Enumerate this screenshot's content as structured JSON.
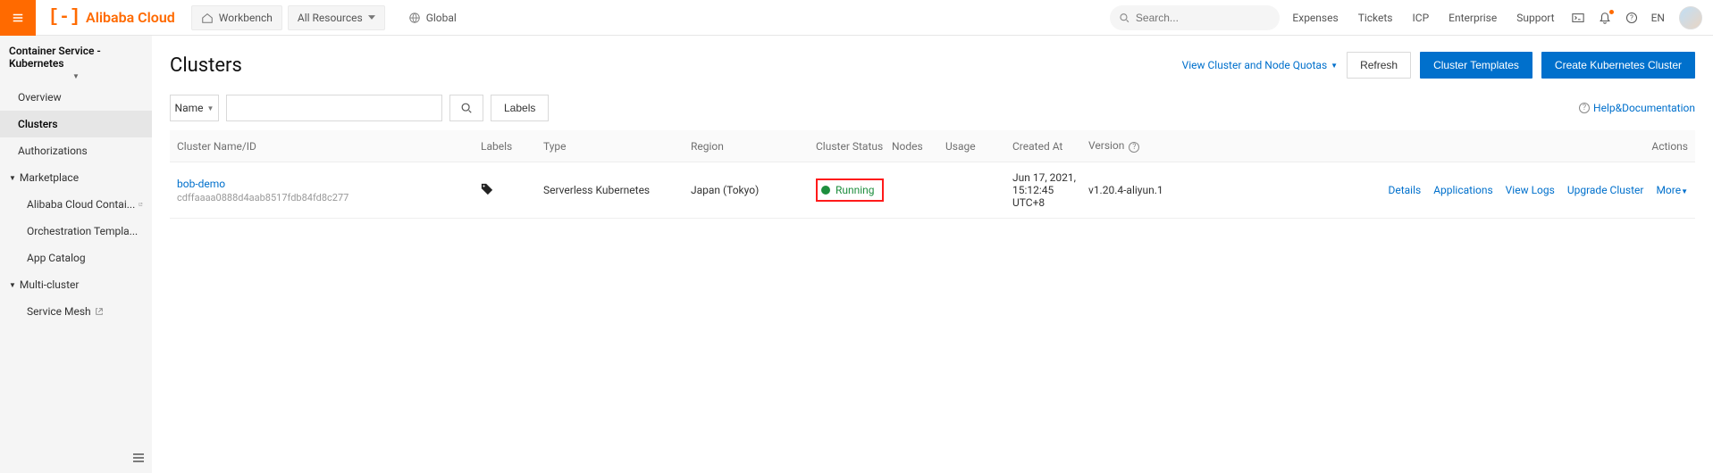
{
  "brand": "Alibaba Cloud",
  "topbar": {
    "workbench": "Workbench",
    "all_resources": "All Resources",
    "global": "Global",
    "search_placeholder": "Search...",
    "links": [
      "Expenses",
      "Tickets",
      "ICP",
      "Enterprise",
      "Support"
    ],
    "lang": "EN"
  },
  "sidebar": {
    "service_title": "Container Service - Kubernetes",
    "items": [
      {
        "label": "Overview"
      },
      {
        "label": "Clusters",
        "active": true
      },
      {
        "label": "Authorizations"
      }
    ],
    "groups": [
      {
        "label": "Marketplace",
        "items": [
          {
            "label": "Alibaba Cloud Contai...",
            "external": true
          },
          {
            "label": "Orchestration Templa..."
          },
          {
            "label": "App Catalog"
          }
        ]
      },
      {
        "label": "Multi-cluster",
        "items": [
          {
            "label": "Service Mesh",
            "external": true
          }
        ]
      }
    ]
  },
  "page": {
    "title": "Clusters",
    "quota_link": "View Cluster and Node Quotas",
    "refresh": "Refresh",
    "templates_btn": "Cluster Templates",
    "create_btn": "Create Kubernetes Cluster",
    "filter_by": "Name",
    "labels_btn": "Labels",
    "help_link": "Help&Documentation"
  },
  "table": {
    "headers": {
      "name": "Cluster Name/ID",
      "labels": "Labels",
      "type": "Type",
      "region": "Region",
      "status": "Cluster Status",
      "nodes": "Nodes",
      "usage": "Usage",
      "created": "Created At",
      "version": "Version",
      "actions": "Actions"
    },
    "rows": [
      {
        "name": "bob-demo",
        "id": "cdffaaaa0888d4aab8517fdb84fd8c277",
        "type": "Serverless Kubernetes",
        "region": "Japan (Tokyo)",
        "status": "Running",
        "created_line1": "Jun 17, 2021,",
        "created_line2": "15:12:45 UTC+8",
        "version": "v1.20.4-aliyun.1",
        "actions": [
          "Details",
          "Applications",
          "View Logs",
          "Upgrade Cluster",
          "More"
        ]
      }
    ]
  }
}
